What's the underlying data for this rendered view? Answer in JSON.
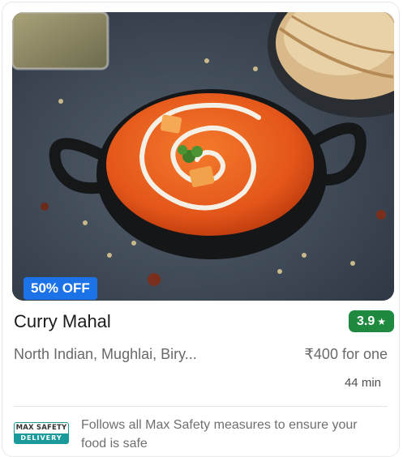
{
  "card": {
    "image_alt": "Paneer butter masala in a black bowl with naan",
    "discount_badge": "50% OFF",
    "restaurant_name": "Curry Mahal",
    "rating": "3.9",
    "rating_color": "#1f8a3f",
    "cuisines": "North Indian, Mughlai, Biry...",
    "price": "₹400 for one",
    "delivery_time": "44 min",
    "safety": {
      "logo_top": "MAX SAFETY",
      "logo_bottom": "DELIVERY",
      "text": "Follows all Max Safety measures to ensure your food is safe"
    }
  },
  "colors": {
    "discount_blue": "#1c73e8",
    "safety_teal": "#1a9a9a"
  },
  "icons": [
    "star-icon"
  ]
}
